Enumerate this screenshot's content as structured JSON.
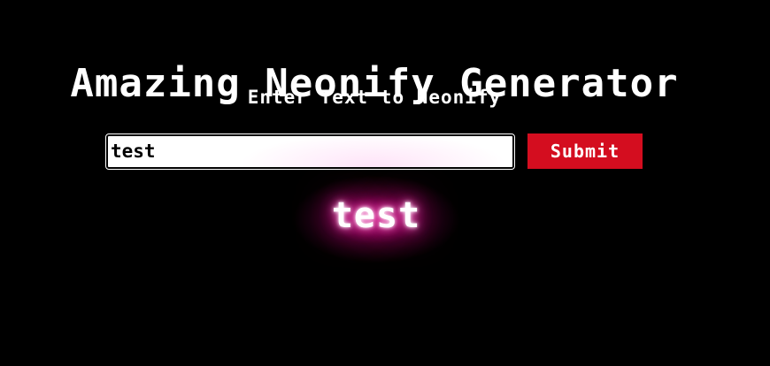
{
  "header": {
    "title": "Amazing Neonify Generator",
    "subtitle": "Enter Text to Neonify"
  },
  "form": {
    "input_value": "test",
    "submit_label": "Submit"
  },
  "output": {
    "neon_text": "test"
  },
  "colors": {
    "background": "#000000",
    "submit_button": "#d40d1f",
    "neon_glow": "#ff2fa8",
    "text": "#ffffff"
  }
}
